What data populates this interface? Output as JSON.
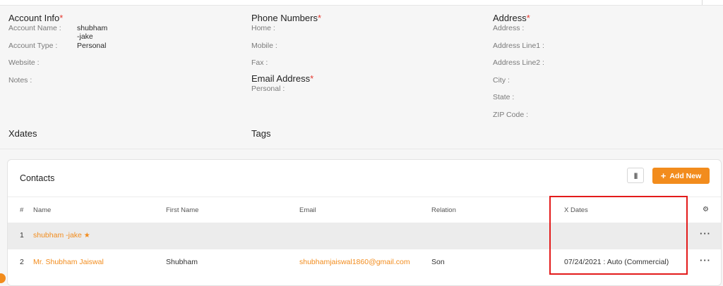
{
  "account": {
    "title": "Account Info",
    "required_mark": "*",
    "fields": [
      {
        "label": "Account Name :",
        "value": "shubham -jake"
      },
      {
        "label": "Account Type :",
        "value": "Personal"
      },
      {
        "label": "Website :",
        "value": ""
      },
      {
        "label": "Notes :",
        "value": ""
      }
    ]
  },
  "phones": {
    "title": "Phone Numbers",
    "required_mark": "*",
    "fields": [
      {
        "label": "Home :"
      },
      {
        "label": "Mobile :"
      },
      {
        "label": "Fax :"
      }
    ]
  },
  "email": {
    "title": "Email Address",
    "required_mark": "*",
    "fields": [
      {
        "label": "Personal :"
      }
    ]
  },
  "address": {
    "title": "Address",
    "required_mark": "*",
    "fields": [
      {
        "label": "Address :"
      },
      {
        "label": "Address Line1 :"
      },
      {
        "label": "Address Line2 :"
      },
      {
        "label": "City :"
      },
      {
        "label": "State :"
      },
      {
        "label": "ZIP Code :"
      }
    ]
  },
  "xdates_title": "Xdates",
  "tags_title": "Tags",
  "contacts": {
    "title": "Contacts",
    "column_toggle_icon": "columns-icon",
    "add_button": {
      "label": "Add New",
      "icon": "+"
    },
    "headers": {
      "hash": "#",
      "name": "Name",
      "first_name": "First Name",
      "email": "Email",
      "relation": "Relation",
      "xdates": "X Dates",
      "settings_icon": "gear-icon"
    },
    "rows": [
      {
        "num": "1",
        "name": "shubham -jake",
        "primary_icon": "star-icon",
        "first_name": "",
        "email": "",
        "relation": "",
        "xdates": "",
        "actions": "···"
      },
      {
        "num": "2",
        "name": "Mr. Shubham Jaiswal",
        "first_name": "Shubham",
        "email": "shubhamjaiswal1860@gmail.com",
        "relation": "Son",
        "xdates": "07/24/2021 : Auto (Commercial)",
        "actions": "···"
      }
    ]
  },
  "colors": {
    "accent": "#f28c1d",
    "required": "#e5382f",
    "highlight_box": "#e31b1b"
  }
}
